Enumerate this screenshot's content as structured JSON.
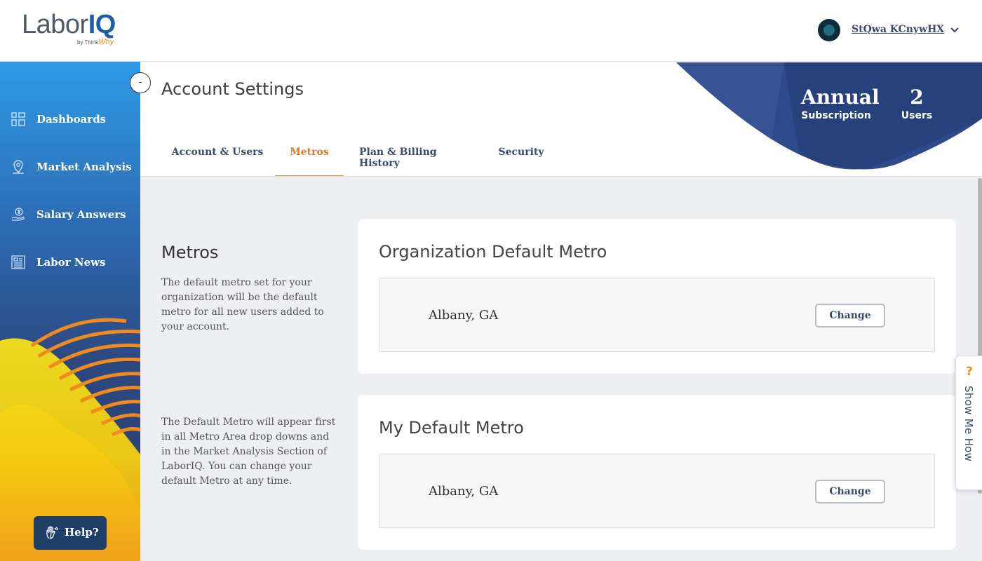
{
  "app": {
    "logo_text": "Labor",
    "logo_bold": "IQ",
    "logo_sub": "by Think",
    "logo_sub_accent": "Why"
  },
  "user": {
    "name": "StQwa KCnywHX"
  },
  "sidebar": {
    "collapse_label": "-",
    "items": [
      {
        "label": "Dashboards",
        "icon": "grid-icon"
      },
      {
        "label": "Market Analysis",
        "icon": "map-pin-icon"
      },
      {
        "label": "Salary Answers",
        "icon": "dollar-hand-icon"
      },
      {
        "label": "Labor News",
        "icon": "newspaper-icon"
      }
    ],
    "help_label": "Help?"
  },
  "header": {
    "title": "Account Settings",
    "tabs": [
      {
        "label": "Account & Users",
        "active": false
      },
      {
        "label": "Metros",
        "active": true
      },
      {
        "label": "Plan & Billing History",
        "active": false
      },
      {
        "label": "Security",
        "active": false
      }
    ],
    "subscription": {
      "value": "Annual",
      "label": "Subscription"
    },
    "users": {
      "value": "2",
      "label": "Users"
    }
  },
  "content": {
    "section_title": "Metros",
    "desc_1": "The default metro set for your organization will be the default metro for all new users added to your account.",
    "desc_2": "The Default Metro will appear first in all Metro Area drop downs and in the Market Analysis Section of LaborIQ. You can change your default Metro at any time.",
    "cards": [
      {
        "title": "Organization Default Metro",
        "value": "Albany, GA",
        "button": "Change"
      },
      {
        "title": "My Default Metro",
        "value": "Albany, GA",
        "button": "Change"
      }
    ]
  },
  "show_me_how": {
    "icon": "?",
    "label": "Show Me How"
  },
  "colors": {
    "accent_orange": "#e08a3c",
    "navy": "#3a4a6a",
    "sidebar_top": "#2f9be6",
    "sidebar_bottom": "#2c3f72",
    "header_art": "#2d4a8a"
  }
}
